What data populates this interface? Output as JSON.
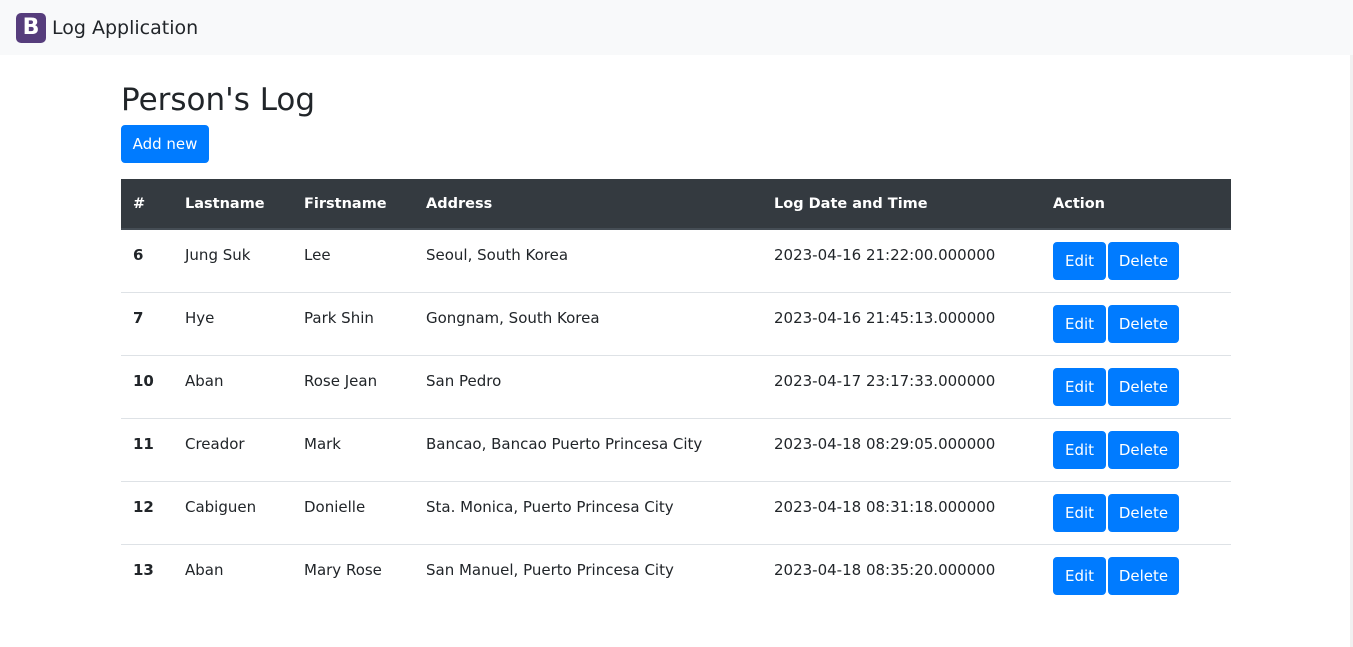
{
  "navbar": {
    "logo_letter": "B",
    "brand": "Log Application"
  },
  "main": {
    "title": "Person's Log",
    "add_button": "Add new"
  },
  "table": {
    "headers": [
      "#",
      "Lastname",
      "Firstname",
      "Address",
      "Log Date and Time",
      "Action"
    ],
    "rows": [
      {
        "id": "6",
        "lastname": "Jung Suk",
        "firstname": "Lee",
        "address": "Seoul, South Korea",
        "datetime": "2023-04-16 21:22:00.000000"
      },
      {
        "id": "7",
        "lastname": "Hye",
        "firstname": "Park Shin",
        "address": "Gongnam, South Korea",
        "datetime": "2023-04-16 21:45:13.000000"
      },
      {
        "id": "10",
        "lastname": "Aban",
        "firstname": "Rose Jean",
        "address": "San Pedro",
        "datetime": "2023-04-17 23:17:33.000000"
      },
      {
        "id": "11",
        "lastname": "Creador",
        "firstname": "Mark",
        "address": "Bancao, Bancao Puerto Princesa City",
        "datetime": "2023-04-18 08:29:05.000000"
      },
      {
        "id": "12",
        "lastname": "Cabiguen",
        "firstname": "Donielle",
        "address": "Sta. Monica, Puerto Princesa City",
        "datetime": "2023-04-18 08:31:18.000000"
      },
      {
        "id": "13",
        "lastname": "Aban",
        "firstname": "Mary Rose",
        "address": "San Manuel, Puerto Princesa City",
        "datetime": "2023-04-18 08:35:20.000000"
      }
    ],
    "edit_label": "Edit",
    "delete_label": "Delete"
  },
  "colors": {
    "primary": "#007bff",
    "navbar_bg": "#f8f9fa",
    "table_header_bg": "#343a40",
    "brand_logo": "#563d7c"
  }
}
